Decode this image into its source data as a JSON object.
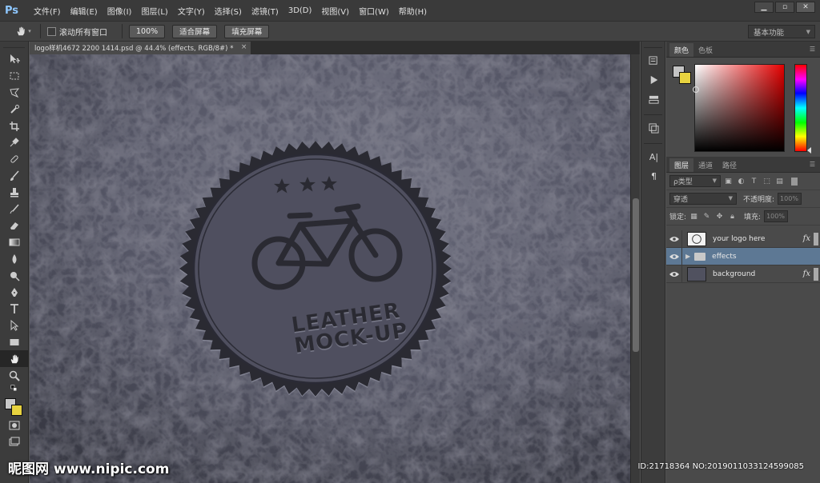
{
  "app": {
    "logo": "Ps"
  },
  "menu": [
    "文件(F)",
    "编辑(E)",
    "图像(I)",
    "图层(L)",
    "文字(Y)",
    "选择(S)",
    "滤镜(T)",
    "3D(D)",
    "视图(V)",
    "窗口(W)",
    "帮助(H)"
  ],
  "window_controls": {
    "minimize": "▁",
    "restore": "▫",
    "close": "✕"
  },
  "options": {
    "scroll_all_label": "滚动所有窗口",
    "btn_100": "100%",
    "btn_fit": "适合屏幕",
    "btn_fill": "填充屏幕",
    "workspace": "基本功能"
  },
  "document": {
    "tab_title": "logo样机4672 2200 1414.psd @ 44.4% (effects, RGB/8#) *"
  },
  "canvas": {
    "line1": "LEATHER",
    "line2": "MOCK-UP",
    "stars": 3,
    "leather_color": "#4e4f5e"
  },
  "color_panel": {
    "tab_color": "颜色",
    "tab_swatches": "色板"
  },
  "layers_panel": {
    "tab_layers": "图层",
    "tab_channels": "通道",
    "tab_paths": "路径",
    "kind_filter": "ρ类型",
    "blend_mode": "穿透",
    "opacity_label": "不透明度:",
    "opacity_value": "100%",
    "lock_label": "锁定:",
    "fill_label": "填充:",
    "fill_value": "100%",
    "layers": [
      {
        "name": "your logo here",
        "fx": "fx",
        "selected": false
      },
      {
        "name": "effects",
        "fx": "",
        "selected": true
      },
      {
        "name": "background",
        "fx": "fx",
        "selected": false
      }
    ]
  },
  "watermark": {
    "brand": "昵图网",
    "site": "www.nipic.com",
    "id_text": "ID:21718364 NO:20190110331245990​85"
  }
}
